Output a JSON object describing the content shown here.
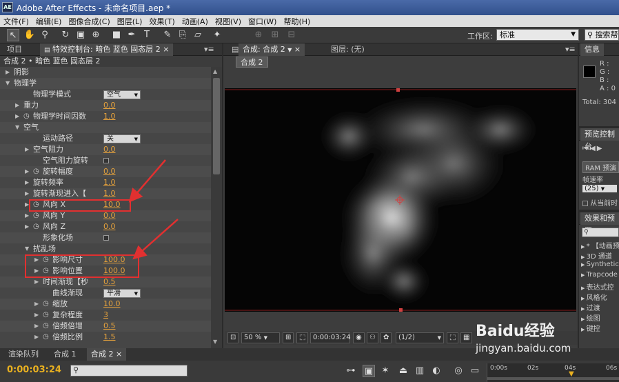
{
  "app": {
    "logo_text": "AE",
    "window_title": "Adobe After Effects - 未命名项目.aep *"
  },
  "menu": [
    "文件(F)",
    "编辑(E)",
    "图像合成(C)",
    "图层(L)",
    "效果(T)",
    "动画(A)",
    "视图(V)",
    "窗口(W)",
    "帮助(H)"
  ],
  "toolbar": {
    "workspace_label": "工作区:",
    "workspace_value": "标准",
    "search_placeholder": "搜索帮"
  },
  "effect_panel": {
    "tab_project": "项目",
    "tab_effect_controls": "特效控制台: 暗色 蓝色 固态层 2",
    "header": "合成 2 • 暗色 蓝色 固态层 2",
    "rows": [
      {
        "label": "阴影",
        "indent": 1,
        "twirl": "closed"
      },
      {
        "label": "物理学",
        "indent": 1,
        "twirl": "open"
      },
      {
        "label": "物理学模式",
        "indent": 3,
        "select": "空气"
      },
      {
        "label": "重力",
        "indent": 2,
        "twirl": "closed",
        "value": "0.0"
      },
      {
        "label": "物理学时间因数",
        "indent": 2,
        "twirl": "closed",
        "stopwatch": true,
        "value": "1.0"
      },
      {
        "label": "空气",
        "indent": 2,
        "twirl": "open"
      },
      {
        "label": "运动路径",
        "indent": 4,
        "select": "关"
      },
      {
        "label": "空气阻力",
        "indent": 3,
        "twirl": "closed",
        "value": "0.0"
      },
      {
        "label": "空气阻力旋转",
        "indent": 4,
        "checkbox": true
      },
      {
        "label": "旋转幅度",
        "indent": 3,
        "twirl": "closed",
        "stopwatch": true,
        "value": "0.0"
      },
      {
        "label": "旋转频率",
        "indent": 3,
        "twirl": "closed",
        "value": "1.0"
      },
      {
        "label": "旋转渐现进入【",
        "indent": 3,
        "twirl": "closed",
        "value": "1.0"
      },
      {
        "label": "风向 X",
        "indent": 3,
        "twirl": "closed",
        "stopwatch": true,
        "value": "10.0"
      },
      {
        "label": "风向 Y",
        "indent": 3,
        "twirl": "closed",
        "stopwatch": true,
        "value": "0.0"
      },
      {
        "label": "风向 Z",
        "indent": 3,
        "twirl": "closed",
        "stopwatch": true,
        "value": "0.0"
      },
      {
        "label": "形象化场",
        "indent": 4,
        "checkbox": true
      },
      {
        "label": "扰乱场",
        "indent": 3,
        "twirl": "open"
      },
      {
        "label": "影响尺寸",
        "indent": 4,
        "twirl": "closed",
        "stopwatch": true,
        "value": "100.0"
      },
      {
        "label": "影响位置",
        "indent": 4,
        "twirl": "closed",
        "stopwatch": true,
        "value": "100.0"
      },
      {
        "label": "时间渐现【秒",
        "indent": 4,
        "twirl": "closed",
        "value": "0.5"
      },
      {
        "label": "曲线渐现",
        "indent": 5,
        "select": "平滑"
      },
      {
        "label": "缩放",
        "indent": 4,
        "twirl": "closed",
        "stopwatch": true,
        "value": "10.0"
      },
      {
        "label": "复杂程度",
        "indent": 4,
        "twirl": "closed",
        "stopwatch": true,
        "value": "3"
      },
      {
        "label": "倍频倍增",
        "indent": 4,
        "twirl": "closed",
        "stopwatch": true,
        "value": "0.5"
      },
      {
        "label": "倍频比例",
        "indent": 4,
        "twirl": "closed",
        "stopwatch": true,
        "value": "1.5"
      }
    ]
  },
  "comp_panel": {
    "tab_comp": "合成: 合成 2",
    "tab_layer": "图层: (无)",
    "subtab": "合成 2",
    "zoom": "50 %",
    "timecode": "0:00:03:24",
    "resolution": "(1/2)"
  },
  "info_panel": {
    "tab": "信息",
    "r": "R :",
    "g": "G :",
    "b": "B :",
    "a": "A : 0",
    "total": "Total: 304"
  },
  "preview_panel": {
    "tab": "预览控制台",
    "ram_button": "RAM 预演",
    "fps_label": "帧速率",
    "fps_value": "(25)",
    "from_current": "从当前时"
  },
  "effects_presets": {
    "tab": "效果和预置",
    "items": [
      "* 【动画预",
      "3D 通道",
      "Synthetic A",
      "Trapcode",
      "表达式控",
      "风格化",
      "过渡",
      "绘图",
      "键控"
    ]
  },
  "timeline": {
    "tabs": [
      "渲染队列",
      "合成 1",
      "合成 2"
    ],
    "timecode": "0:00:03:24",
    "ruler_labels": [
      "0:00s",
      "02s",
      "04s",
      "06s"
    ]
  },
  "watermark": {
    "brand": "Baidu经验",
    "url": "jingyan.baidu.com"
  },
  "colors": {
    "accent_value": "#e6a23c",
    "annotation_red": "#e23030",
    "timecode": "#e8b020"
  }
}
